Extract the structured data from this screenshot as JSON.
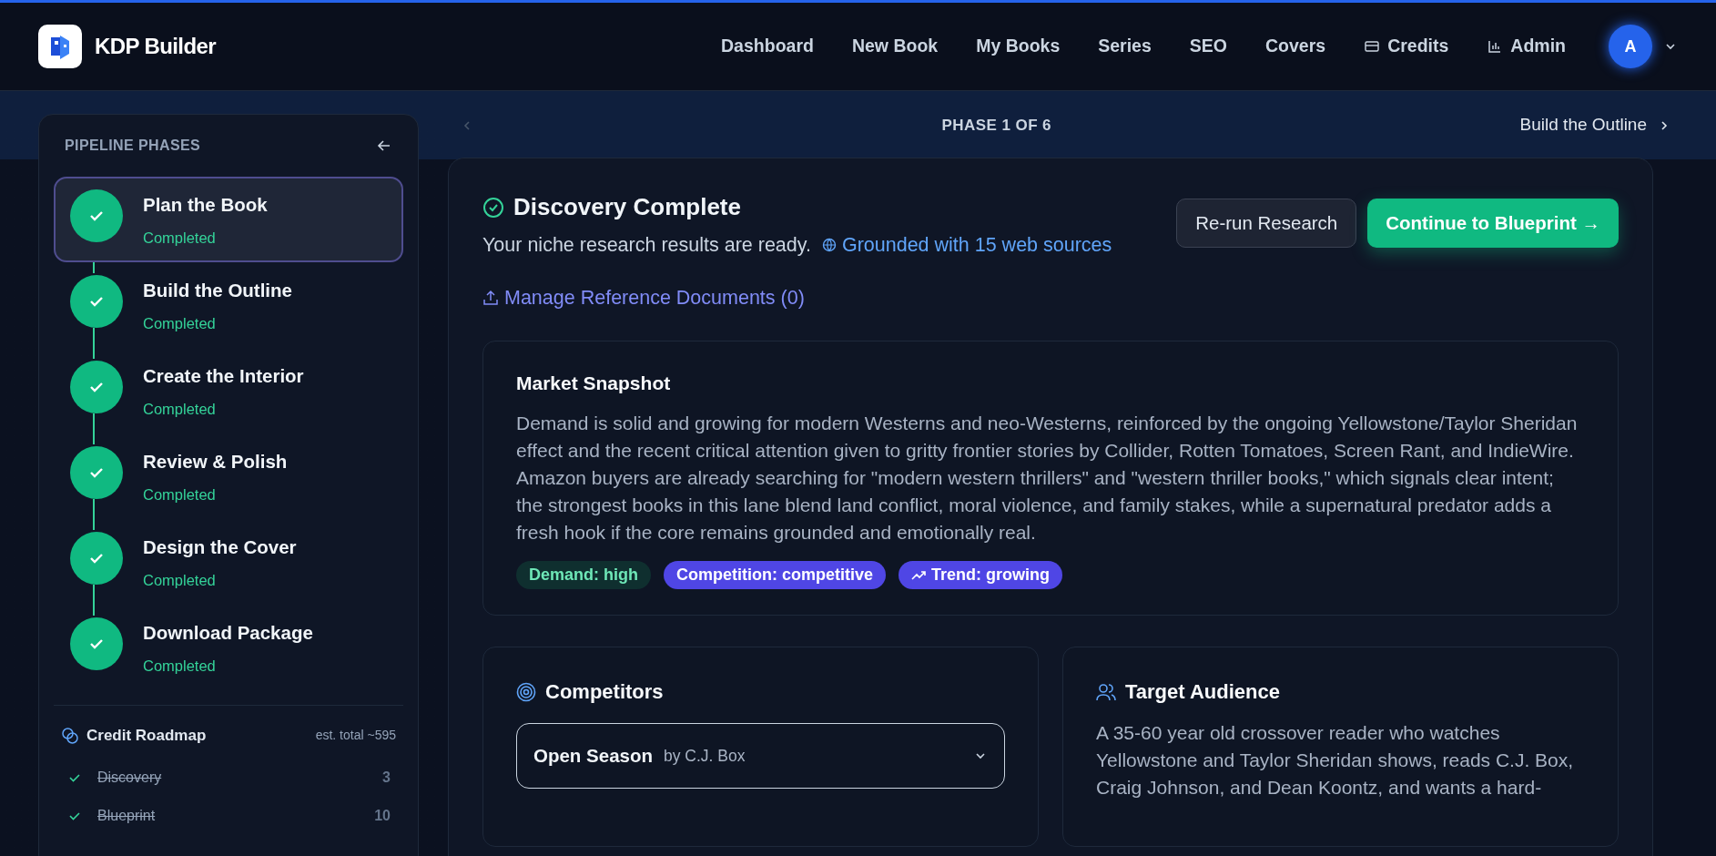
{
  "header": {
    "brand": "KDP Builder",
    "nav": [
      {
        "label": "Dashboard",
        "kind": "plain"
      },
      {
        "label": "New Book",
        "kind": "plain"
      },
      {
        "label": "My Books",
        "kind": "plain"
      },
      {
        "label": "Series",
        "kind": "plain"
      },
      {
        "label": "SEO",
        "kind": "plain"
      },
      {
        "label": "Covers",
        "kind": "plain"
      },
      {
        "label": "Credits",
        "kind": "card"
      },
      {
        "label": "Admin",
        "kind": "chart"
      }
    ],
    "avatar": "A"
  },
  "phase_nav": {
    "label": "PHASE 1 OF 6",
    "next": "Build the Outline"
  },
  "sidebar": {
    "title": "PIPELINE PHASES",
    "phases": [
      {
        "name": "Plan the Book",
        "status": "Completed",
        "completed": true,
        "selected": true
      },
      {
        "name": "Build the Outline",
        "status": "Completed",
        "completed": true,
        "selected": false
      },
      {
        "name": "Create the Interior",
        "status": "Completed",
        "completed": true,
        "selected": false
      },
      {
        "name": "Review & Polish",
        "status": "Completed",
        "completed": true,
        "selected": false
      },
      {
        "name": "Design the Cover",
        "status": "Completed",
        "completed": true,
        "selected": false
      },
      {
        "name": "Download Package",
        "status": "Completed",
        "completed": true,
        "selected": false
      }
    ],
    "credit_roadmap": {
      "title": "Credit Roadmap",
      "total": "est. total ~595",
      "items": [
        {
          "name": "Discovery",
          "cost": "3",
          "done": true
        },
        {
          "name": "Blueprint",
          "cost": "10",
          "done": true
        }
      ]
    }
  },
  "main": {
    "title": "Discovery Complete",
    "subtitle": "Your niche research results are ready.",
    "sources": "Grounded with 15 web sources",
    "buttons": [
      {
        "label": "Re-run Research",
        "kind": "secondary"
      },
      {
        "label": "Continue to Blueprint →",
        "kind": "primary"
      }
    ],
    "reference_link": "Manage Reference Documents (0)",
    "market_snapshot": {
      "title": "Market Snapshot",
      "text": "Demand is solid and growing for modern Westerns and neo-Westerns, reinforced by the ongoing Yellowstone/Taylor Sheridan effect and the recent critical attention given to gritty frontier stories by Collider, Rotten Tomatoes, Screen Rant, and IndieWire. Amazon buyers are already searching for \"modern western thrillers\" and \"western thriller books,\" which signals clear intent; the strongest books in this lane blend land conflict, moral violence, and family stakes, while a supernatural predator adds a fresh hook if the core remains grounded and emotionally real.",
      "tags": [
        {
          "label": "Demand: high",
          "kind": "demand"
        },
        {
          "label": "Competition: competitive",
          "kind": "competition"
        },
        {
          "label": "Trend: growing",
          "kind": "trend"
        }
      ]
    },
    "competitors": {
      "title": "Competitors",
      "items": [
        {
          "title": "Open Season",
          "author": "by C.J. Box",
          "expanded": false
        }
      ]
    },
    "target_audience": {
      "title": "Target Audience",
      "text": "A 35-60 year old crossover reader who watches Yellowstone and Taylor Sheridan shows, reads C.J. Box, Craig Johnson, and Dean Koontz, and wants a hard-"
    }
  }
}
